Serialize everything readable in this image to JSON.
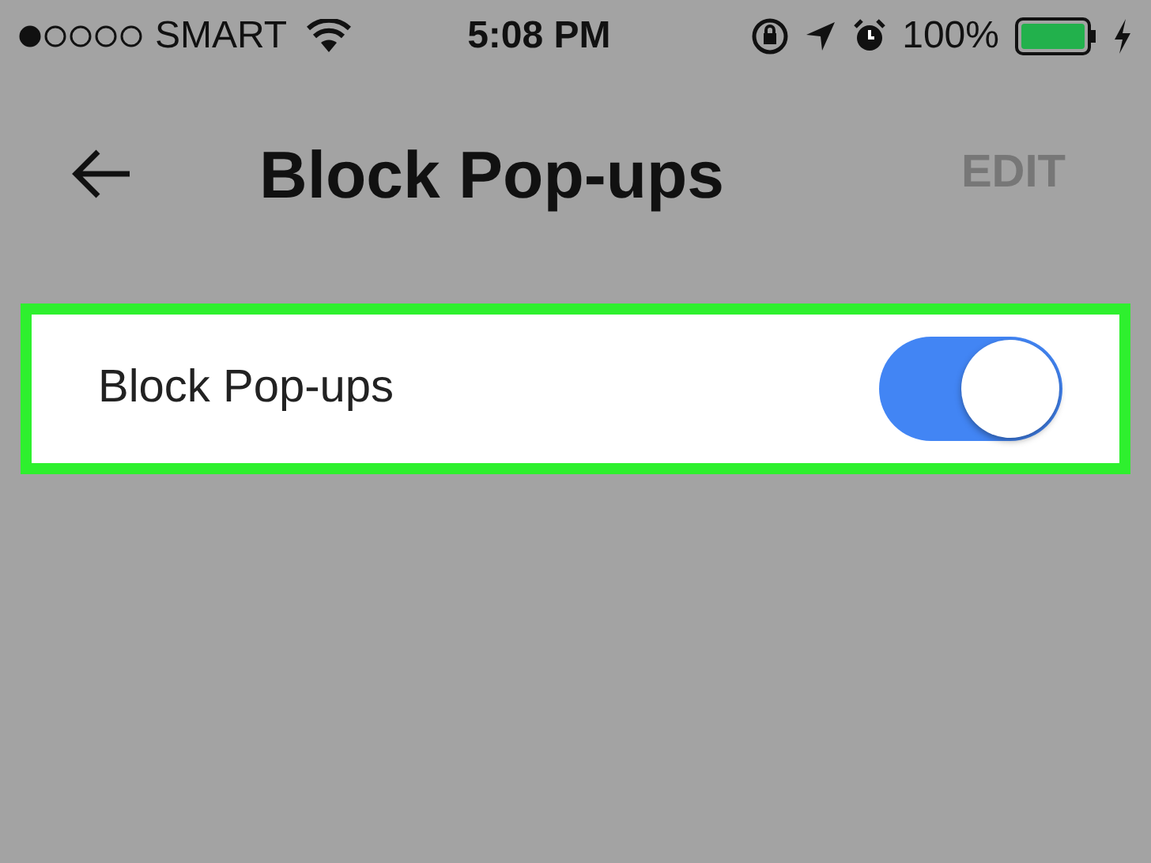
{
  "status_bar": {
    "carrier": "SMART",
    "time": "5:08 PM",
    "battery": "100%"
  },
  "header": {
    "title": "Block Pop-ups",
    "action": "EDIT"
  },
  "settings": [
    {
      "label": "Block Pop-ups",
      "on": true,
      "highlighted": true
    }
  ]
}
